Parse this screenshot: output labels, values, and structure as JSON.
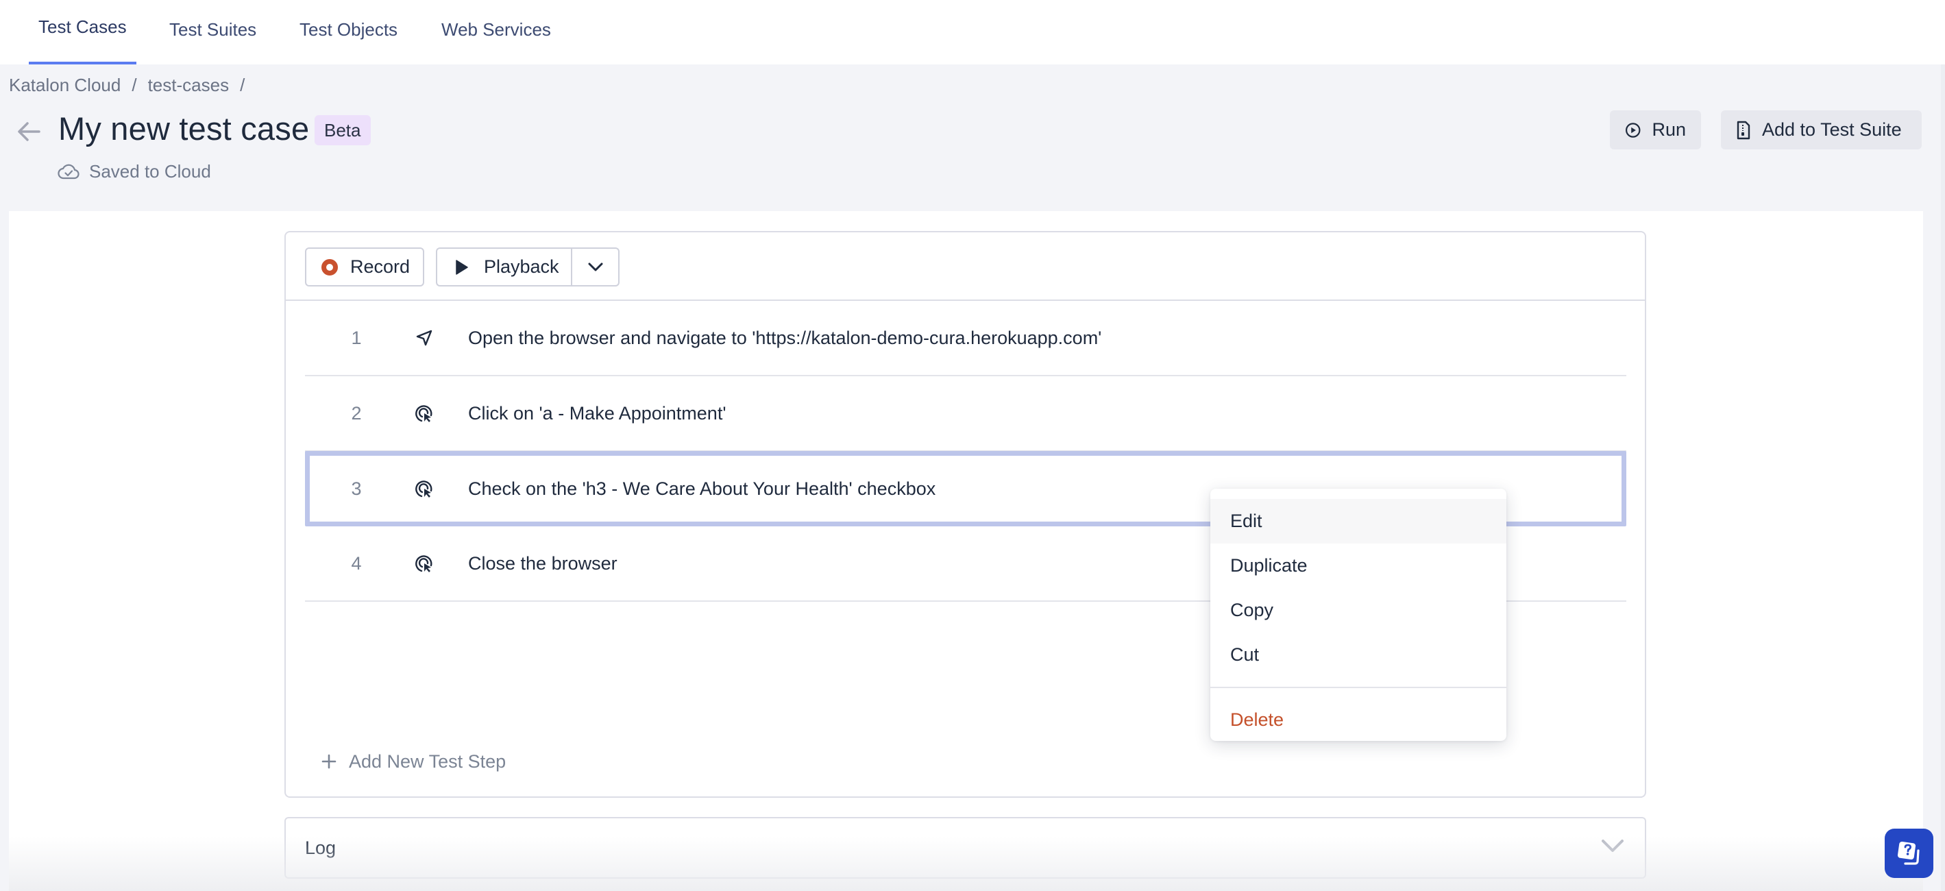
{
  "nav": {
    "tabs": [
      {
        "label": "Test Cases",
        "active": true
      },
      {
        "label": "Test Suites",
        "active": false
      },
      {
        "label": "Test Objects",
        "active": false
      },
      {
        "label": "Web Services",
        "active": false
      }
    ]
  },
  "breadcrumb": {
    "items": [
      "Katalon Cloud",
      "test-cases"
    ],
    "separator": "/"
  },
  "header": {
    "title": "My new test case",
    "badge": "Beta",
    "save_status": "Saved to Cloud",
    "run_label": "Run",
    "add_to_suite_label": "Add to Test Suite"
  },
  "toolbar": {
    "record_label": "Record",
    "playback_label": "Playback"
  },
  "steps": [
    {
      "number": "1",
      "icon": "navigate-icon",
      "description": "Open the browser and navigate to 'https://katalon-demo-cura.herokuapp.com'",
      "selected": false
    },
    {
      "number": "2",
      "icon": "click-icon",
      "description": "Click on 'a - Make Appointment'",
      "selected": false
    },
    {
      "number": "3",
      "icon": "click-icon",
      "description": "Check on the 'h3 - We Care About Your Health' checkbox",
      "selected": true
    },
    {
      "number": "4",
      "icon": "click-icon",
      "description": "Close the browser",
      "selected": false
    }
  ],
  "add_step_label": "Add New Test Step",
  "log": {
    "label": "Log"
  },
  "context_menu": {
    "items": [
      {
        "label": "Edit",
        "hover": true
      },
      {
        "label": "Duplicate"
      },
      {
        "label": "Copy"
      },
      {
        "label": "Cut"
      }
    ],
    "danger_item": {
      "label": "Delete"
    }
  },
  "colors": {
    "accent": "#5b7cf0",
    "record": "#c9512e",
    "danger": "#c4502a",
    "selected_border": "#bcc5ea",
    "beta_badge_bg": "#ede0fb",
    "help_button": "#2447c4"
  }
}
